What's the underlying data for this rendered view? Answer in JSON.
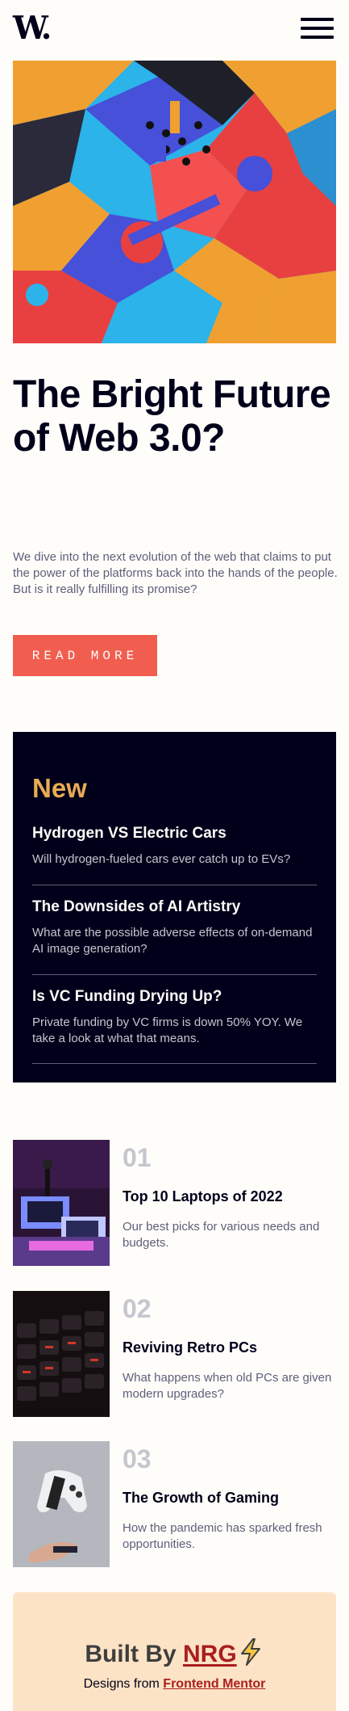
{
  "header": {
    "logo_text": "W.",
    "menu_icon": "hamburger-menu-icon"
  },
  "hero": {
    "image_alt": "abstract colorful 3d blocks",
    "title": "The Bright Future of Web 3.0?",
    "description": "We dive into the next evolution of the web that claims to put the power of the platforms back into the hands of the people. But is it really fulfilling its promise?",
    "button_label": "READ MORE"
  },
  "new_section": {
    "heading": "New",
    "items": [
      {
        "title": "Hydrogen VS Electric Cars",
        "description": "Will hydrogen-fueled cars ever catch up to EVs?"
      },
      {
        "title": "The Downsides of AI Artistry",
        "description": "What are the possible adverse effects of on-demand AI image generation?"
      },
      {
        "title": "Is VC Funding Drying Up?",
        "description": "Private funding by VC firms is down 50% YOY. We take a look at what that means."
      }
    ]
  },
  "ranked": [
    {
      "number": "01",
      "title": "Top 10 Laptops of 2022",
      "description": "Our best picks for various needs and budgets."
    },
    {
      "number": "02",
      "title": "Reviving Retro PCs",
      "description": "What happens when old PCs are given modern upgrades?"
    },
    {
      "number": "03",
      "title": "The Growth of Gaming",
      "description": "How the pandemic has sparked fresh opportunities."
    }
  ],
  "footer": {
    "built_by_prefix": "Built By",
    "built_by_name": "NRG",
    "credit_prefix": "Designs from",
    "credit_link": "Frontend Mentor"
  },
  "colors": {
    "accent_red": "#f15e50",
    "accent_orange": "#e9ab53",
    "dark_navy": "#00001a",
    "off_white": "#fffdfa",
    "footer_bg": "#fde3c5",
    "link_red": "#a91e1e"
  }
}
